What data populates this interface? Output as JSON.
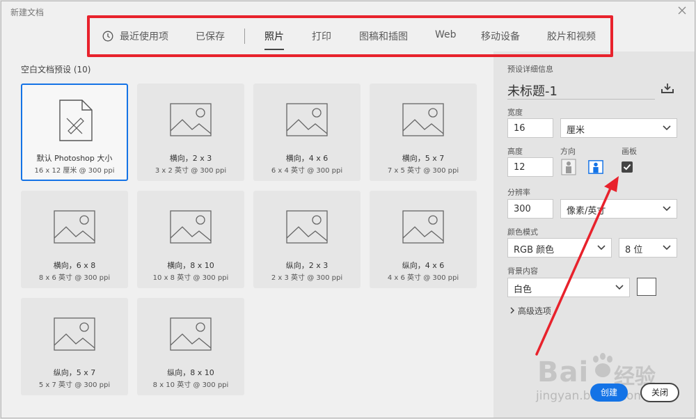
{
  "window": {
    "title": "新建文档"
  },
  "tabs": [
    {
      "label": "最近使用项",
      "icon": "clock-icon"
    },
    {
      "label": "已保存"
    },
    {
      "label": "照片",
      "active": true
    },
    {
      "label": "打印"
    },
    {
      "label": "图稿和插图"
    },
    {
      "label": "Web"
    },
    {
      "label": "移动设备"
    },
    {
      "label": "胶片和视频"
    }
  ],
  "presets": {
    "title": "空白文档预设 (10)",
    "items": [
      {
        "name": "默认 Photoshop 大小",
        "spec": "16 x 12 厘米 @ 300 ppi",
        "selected": true,
        "icon": "document-icon"
      },
      {
        "name": "横向，2 x 3",
        "spec": "3 x 2 英寸 @ 300 ppi",
        "icon": "image-icon"
      },
      {
        "name": "横向，4 x 6",
        "spec": "6 x 4 英寸 @ 300 ppi",
        "icon": "image-icon"
      },
      {
        "name": "横向，5 x 7",
        "spec": "7 x 5 英寸 @ 300 ppi",
        "icon": "image-icon"
      },
      {
        "name": "横向，6 x 8",
        "spec": "8 x 6 英寸 @ 300 ppi",
        "icon": "image-icon"
      },
      {
        "name": "横向，8 x 10",
        "spec": "10 x 8 英寸 @ 300 ppi",
        "icon": "image-icon"
      },
      {
        "name": "纵向，2 x 3",
        "spec": "2 x 3 英寸 @ 300 ppi",
        "icon": "image-icon"
      },
      {
        "name": "纵向，4 x 6",
        "spec": "4 x 6 英寸 @ 300 ppi",
        "icon": "image-icon"
      },
      {
        "name": "纵向，5 x 7",
        "spec": "5 x 7 英寸 @ 300 ppi",
        "icon": "image-icon"
      },
      {
        "name": "纵向，8 x 10",
        "spec": "8 x 10 英寸 @ 300 ppi",
        "icon": "image-icon"
      }
    ]
  },
  "details": {
    "header": "预设详细信息",
    "doc_name": "未标题-1",
    "width_label": "宽度",
    "width_value": "16",
    "width_unit": "厘米",
    "height_label": "高度",
    "height_value": "12",
    "orientation_label": "方向",
    "artboard_label": "画板",
    "artboard_checked": true,
    "resolution_label": "分辨率",
    "resolution_value": "300",
    "resolution_unit": "像素/英寸",
    "color_mode_label": "颜色模式",
    "color_mode": "RGB 颜色",
    "bit_depth": "8 位",
    "background_label": "背景内容",
    "background": "白色",
    "background_swatch": "#ffffff",
    "advanced": "高级选项"
  },
  "buttons": {
    "create": "创建",
    "close": "关闭"
  },
  "annotation": {
    "box_color": "#e8222c",
    "arrow_color": "#e8222c"
  },
  "watermark": {
    "text": "Bai",
    "brand_cn": "经验",
    "url": "jingyan.baidu.com"
  },
  "colors": {
    "accent": "#1473e6"
  }
}
